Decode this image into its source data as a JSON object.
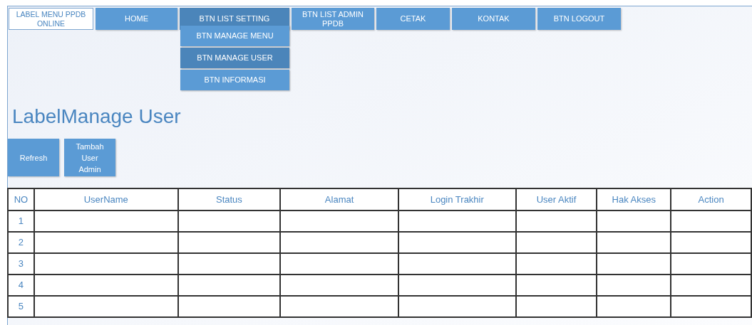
{
  "app_label": "LABEL MENU PPDB ONLINE",
  "nav": [
    {
      "label": "HOME",
      "selected": false
    },
    {
      "label": "BTN LIST SETTING",
      "selected": true,
      "expanded": true,
      "menu": [
        {
          "label": "BTN MANAGE MENU",
          "selected": false
        },
        {
          "label": "BTN MANAGE USER",
          "selected": true
        },
        {
          "label": "BTN INFORMASI",
          "selected": false
        }
      ]
    },
    {
      "label": "BTN LIST ADMIN PPDB",
      "selected": false
    },
    {
      "label": "CETAK",
      "selected": false
    },
    {
      "label": "KONTAK",
      "selected": false
    },
    {
      "label": "BTN LOGOUT",
      "selected": false
    }
  ],
  "page_title": "LabelManage User",
  "buttons": [
    "Refresh",
    "Tambah User Admin"
  ],
  "table": {
    "columns": [
      "NO",
      "UserName",
      "Status",
      "Alamat",
      "Login Trakhir",
      "User Aktif",
      "Hak Akses",
      "Action"
    ],
    "rows": [
      {
        "no": "1"
      },
      {
        "no": "2"
      },
      {
        "no": "3"
      },
      {
        "no": "4"
      },
      {
        "no": "5"
      }
    ]
  }
}
